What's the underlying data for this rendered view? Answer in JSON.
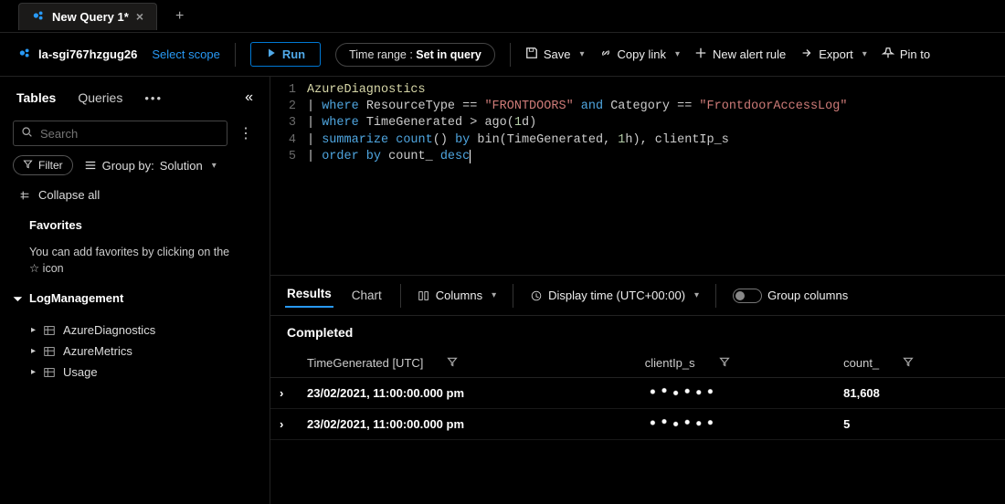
{
  "tabs": {
    "active_title": "New Query 1*"
  },
  "scope": {
    "workspace": "la-sgi767hzgug26",
    "select_label": "Select scope"
  },
  "toolbar": {
    "run_label": "Run",
    "time_range_label": "Time range :",
    "time_range_value": "Set in query",
    "save_label": "Save",
    "copy_link_label": "Copy link",
    "new_alert_label": "New alert rule",
    "export_label": "Export",
    "pin_label": "Pin to"
  },
  "sidebar": {
    "tabs": {
      "tables": "Tables",
      "queries": "Queries"
    },
    "search_placeholder": "Search",
    "filter_label": "Filter",
    "group_by_prefix": "Group by:",
    "group_by_value": "Solution",
    "collapse_all": "Collapse all",
    "favorites_title": "Favorites",
    "favorites_hint": "You can add favorites by clicking on the ☆ icon",
    "category": "LogManagement",
    "tables": [
      "AzureDiagnostics",
      "AzureMetrics",
      "Usage"
    ]
  },
  "editor": {
    "lines": [
      {
        "n": 1,
        "tokens": [
          {
            "t": "AzureDiagnostics",
            "c": "id"
          }
        ]
      },
      {
        "n": 2,
        "tokens": [
          {
            "t": "| "
          },
          {
            "t": "where",
            "c": "kw"
          },
          {
            "t": " ResourceType == "
          },
          {
            "t": "\"FRONTDOORS\"",
            "c": "str"
          },
          {
            "t": " "
          },
          {
            "t": "and",
            "c": "kw"
          },
          {
            "t": " Category == "
          },
          {
            "t": "\"FrontdoorAccessLog\"",
            "c": "str"
          }
        ]
      },
      {
        "n": 3,
        "tokens": [
          {
            "t": "| "
          },
          {
            "t": "where",
            "c": "kw"
          },
          {
            "t": " TimeGenerated > ago("
          },
          {
            "t": "1",
            "c": "num"
          },
          {
            "t": "d)"
          }
        ]
      },
      {
        "n": 4,
        "tokens": [
          {
            "t": "| "
          },
          {
            "t": "summarize",
            "c": "kw"
          },
          {
            "t": " "
          },
          {
            "t": "count",
            "c": "kw"
          },
          {
            "t": "() "
          },
          {
            "t": "by",
            "c": "kw"
          },
          {
            "t": " bin(TimeGenerated, "
          },
          {
            "t": "1",
            "c": "num"
          },
          {
            "t": "h), clientIp_s"
          }
        ]
      },
      {
        "n": 5,
        "tokens": [
          {
            "t": "| "
          },
          {
            "t": "order by",
            "c": "kw"
          },
          {
            "t": " count_ "
          },
          {
            "t": "desc",
            "c": "kw",
            "cursor": true
          }
        ]
      }
    ]
  },
  "results": {
    "tabs": {
      "results": "Results",
      "chart": "Chart"
    },
    "columns_label": "Columns",
    "display_time_label": "Display time (UTC+00:00)",
    "group_columns_label": "Group columns",
    "status": "Completed",
    "headers": [
      "TimeGenerated [UTC]",
      "clientIp_s",
      "count_"
    ],
    "rows": [
      {
        "time": "23/02/2021, 11:00:00.000 pm",
        "ip": "[redacted]",
        "count": "81,608"
      },
      {
        "time": "23/02/2021, 11:00:00.000 pm",
        "ip": "[redacted]",
        "count": "5"
      }
    ]
  }
}
